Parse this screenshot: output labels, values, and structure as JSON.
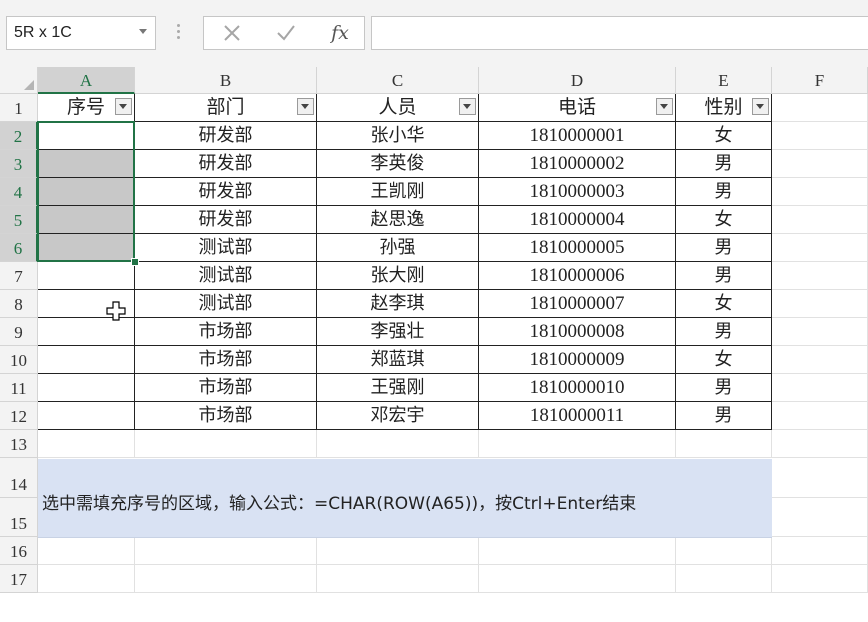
{
  "namebox": {
    "value": "5R x 1C"
  },
  "formula_bar": {
    "fx_label": "fx",
    "cancel_icon": "cross-icon",
    "enter_icon": "check-icon",
    "content": ""
  },
  "columns": [
    "A",
    "B",
    "C",
    "D",
    "E",
    "F"
  ],
  "rows": [
    "1",
    "2",
    "3",
    "4",
    "5",
    "6",
    "7",
    "8",
    "9",
    "10",
    "11",
    "12",
    "13",
    "14",
    "15",
    "16",
    "17"
  ],
  "table": {
    "headers": [
      "序号",
      "部门",
      "人员",
      "电话",
      "性别"
    ],
    "data": [
      [
        "",
        "研发部",
        "张小华",
        "1810000001",
        "女"
      ],
      [
        "",
        "研发部",
        "李英俊",
        "1810000002",
        "男"
      ],
      [
        "",
        "研发部",
        "王凯刚",
        "1810000003",
        "男"
      ],
      [
        "",
        "研发部",
        "赵思逸",
        "1810000004",
        "女"
      ],
      [
        "",
        "测试部",
        "孙强",
        "1810000005",
        "男"
      ],
      [
        "",
        "测试部",
        "张大刚",
        "1810000006",
        "男"
      ],
      [
        "",
        "测试部",
        "赵李琪",
        "1810000007",
        "女"
      ],
      [
        "",
        "市场部",
        "李强壮",
        "1810000008",
        "男"
      ],
      [
        "",
        "市场部",
        "郑蓝琪",
        "1810000009",
        "女"
      ],
      [
        "",
        "市场部",
        "王强刚",
        "1810000010",
        "男"
      ],
      [
        "",
        "市场部",
        "邓宏宇",
        "1810000011",
        "男"
      ]
    ]
  },
  "note": {
    "text": "选中需填充序号的区域，输入公式：=CHAR(ROW(A65))，按Ctrl+Enter结束"
  },
  "colors": {
    "accent": "#217346",
    "note_bg": "#d9e2f3",
    "selection_fill": "#c8c8c8"
  }
}
